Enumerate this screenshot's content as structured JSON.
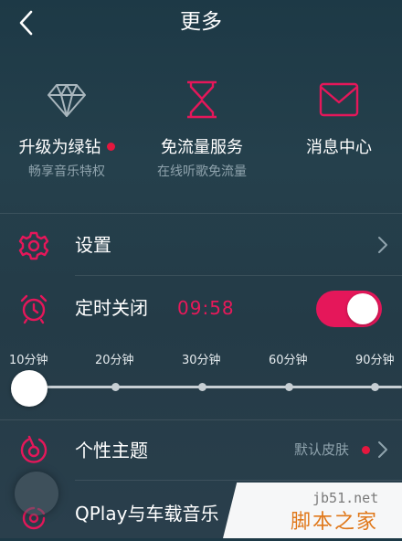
{
  "header": {
    "title": "更多"
  },
  "features": [
    {
      "title": "升级为绿钻",
      "subtitle": "畅享音乐特权",
      "icon": "diamond-icon",
      "badge": true
    },
    {
      "title": "免流量服务",
      "subtitle": "在线听歌免流量",
      "icon": "hourglass-icon"
    },
    {
      "title": "消息中心",
      "subtitle": "",
      "icon": "envelope-icon"
    }
  ],
  "settings": {
    "label": "设置"
  },
  "sleep_timer": {
    "label": "定时关闭",
    "time": "09:58",
    "enabled": true,
    "options": [
      "10分钟",
      "20分钟",
      "30分钟",
      "60分钟",
      "90分钟"
    ],
    "selected": "10分钟"
  },
  "theme": {
    "label": "个性主题",
    "value": "默认皮肤"
  },
  "qplay": {
    "label": "QPlay与车载音乐"
  },
  "watermark": {
    "site": "jb51.net",
    "name": "脚本之家"
  },
  "colors": {
    "accent": "#e5175a",
    "text_secondary": "#8fa3ad",
    "bg": "#243b47"
  }
}
